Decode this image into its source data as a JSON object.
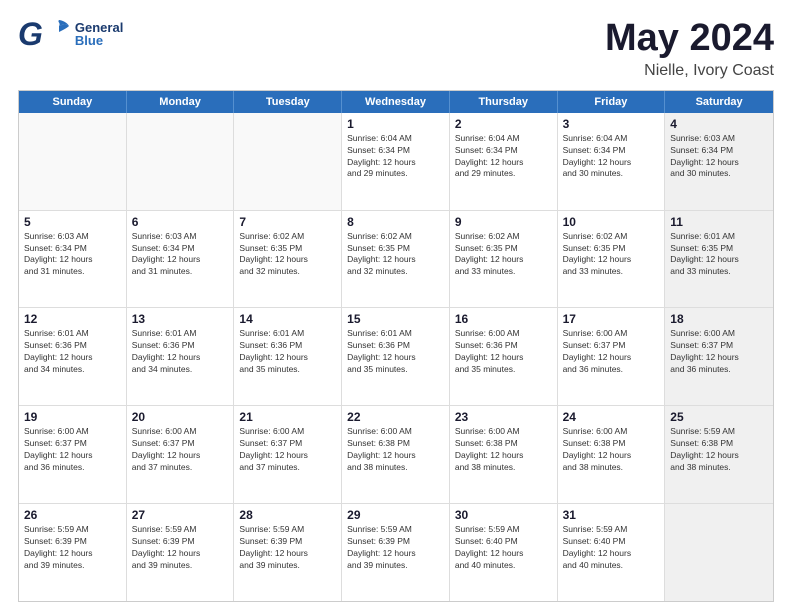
{
  "header": {
    "logo_general": "General",
    "logo_blue": "Blue",
    "title": "May 2024",
    "subtitle": "Nielle, Ivory Coast"
  },
  "days_of_week": [
    "Sunday",
    "Monday",
    "Tuesday",
    "Wednesday",
    "Thursday",
    "Friday",
    "Saturday"
  ],
  "weeks": [
    [
      {
        "day": "",
        "empty": true
      },
      {
        "day": "",
        "empty": true
      },
      {
        "day": "",
        "empty": true
      },
      {
        "day": "1",
        "line1": "Sunrise: 6:04 AM",
        "line2": "Sunset: 6:34 PM",
        "line3": "Daylight: 12 hours",
        "line4": "and 29 minutes."
      },
      {
        "day": "2",
        "line1": "Sunrise: 6:04 AM",
        "line2": "Sunset: 6:34 PM",
        "line3": "Daylight: 12 hours",
        "line4": "and 29 minutes."
      },
      {
        "day": "3",
        "line1": "Sunrise: 6:04 AM",
        "line2": "Sunset: 6:34 PM",
        "line3": "Daylight: 12 hours",
        "line4": "and 30 minutes."
      },
      {
        "day": "4",
        "shaded": true,
        "line1": "Sunrise: 6:03 AM",
        "line2": "Sunset: 6:34 PM",
        "line3": "Daylight: 12 hours",
        "line4": "and 30 minutes."
      }
    ],
    [
      {
        "day": "5",
        "line1": "Sunrise: 6:03 AM",
        "line2": "Sunset: 6:34 PM",
        "line3": "Daylight: 12 hours",
        "line4": "and 31 minutes."
      },
      {
        "day": "6",
        "line1": "Sunrise: 6:03 AM",
        "line2": "Sunset: 6:34 PM",
        "line3": "Daylight: 12 hours",
        "line4": "and 31 minutes."
      },
      {
        "day": "7",
        "line1": "Sunrise: 6:02 AM",
        "line2": "Sunset: 6:35 PM",
        "line3": "Daylight: 12 hours",
        "line4": "and 32 minutes."
      },
      {
        "day": "8",
        "line1": "Sunrise: 6:02 AM",
        "line2": "Sunset: 6:35 PM",
        "line3": "Daylight: 12 hours",
        "line4": "and 32 minutes."
      },
      {
        "day": "9",
        "line1": "Sunrise: 6:02 AM",
        "line2": "Sunset: 6:35 PM",
        "line3": "Daylight: 12 hours",
        "line4": "and 33 minutes."
      },
      {
        "day": "10",
        "line1": "Sunrise: 6:02 AM",
        "line2": "Sunset: 6:35 PM",
        "line3": "Daylight: 12 hours",
        "line4": "and 33 minutes."
      },
      {
        "day": "11",
        "shaded": true,
        "line1": "Sunrise: 6:01 AM",
        "line2": "Sunset: 6:35 PM",
        "line3": "Daylight: 12 hours",
        "line4": "and 33 minutes."
      }
    ],
    [
      {
        "day": "12",
        "line1": "Sunrise: 6:01 AM",
        "line2": "Sunset: 6:36 PM",
        "line3": "Daylight: 12 hours",
        "line4": "and 34 minutes."
      },
      {
        "day": "13",
        "line1": "Sunrise: 6:01 AM",
        "line2": "Sunset: 6:36 PM",
        "line3": "Daylight: 12 hours",
        "line4": "and 34 minutes."
      },
      {
        "day": "14",
        "line1": "Sunrise: 6:01 AM",
        "line2": "Sunset: 6:36 PM",
        "line3": "Daylight: 12 hours",
        "line4": "and 35 minutes."
      },
      {
        "day": "15",
        "line1": "Sunrise: 6:01 AM",
        "line2": "Sunset: 6:36 PM",
        "line3": "Daylight: 12 hours",
        "line4": "and 35 minutes."
      },
      {
        "day": "16",
        "line1": "Sunrise: 6:00 AM",
        "line2": "Sunset: 6:36 PM",
        "line3": "Daylight: 12 hours",
        "line4": "and 35 minutes."
      },
      {
        "day": "17",
        "line1": "Sunrise: 6:00 AM",
        "line2": "Sunset: 6:37 PM",
        "line3": "Daylight: 12 hours",
        "line4": "and 36 minutes."
      },
      {
        "day": "18",
        "shaded": true,
        "line1": "Sunrise: 6:00 AM",
        "line2": "Sunset: 6:37 PM",
        "line3": "Daylight: 12 hours",
        "line4": "and 36 minutes."
      }
    ],
    [
      {
        "day": "19",
        "line1": "Sunrise: 6:00 AM",
        "line2": "Sunset: 6:37 PM",
        "line3": "Daylight: 12 hours",
        "line4": "and 36 minutes."
      },
      {
        "day": "20",
        "line1": "Sunrise: 6:00 AM",
        "line2": "Sunset: 6:37 PM",
        "line3": "Daylight: 12 hours",
        "line4": "and 37 minutes."
      },
      {
        "day": "21",
        "line1": "Sunrise: 6:00 AM",
        "line2": "Sunset: 6:37 PM",
        "line3": "Daylight: 12 hours",
        "line4": "and 37 minutes."
      },
      {
        "day": "22",
        "line1": "Sunrise: 6:00 AM",
        "line2": "Sunset: 6:38 PM",
        "line3": "Daylight: 12 hours",
        "line4": "and 38 minutes."
      },
      {
        "day": "23",
        "line1": "Sunrise: 6:00 AM",
        "line2": "Sunset: 6:38 PM",
        "line3": "Daylight: 12 hours",
        "line4": "and 38 minutes."
      },
      {
        "day": "24",
        "line1": "Sunrise: 6:00 AM",
        "line2": "Sunset: 6:38 PM",
        "line3": "Daylight: 12 hours",
        "line4": "and 38 minutes."
      },
      {
        "day": "25",
        "shaded": true,
        "line1": "Sunrise: 5:59 AM",
        "line2": "Sunset: 6:38 PM",
        "line3": "Daylight: 12 hours",
        "line4": "and 38 minutes."
      }
    ],
    [
      {
        "day": "26",
        "line1": "Sunrise: 5:59 AM",
        "line2": "Sunset: 6:39 PM",
        "line3": "Daylight: 12 hours",
        "line4": "and 39 minutes."
      },
      {
        "day": "27",
        "line1": "Sunrise: 5:59 AM",
        "line2": "Sunset: 6:39 PM",
        "line3": "Daylight: 12 hours",
        "line4": "and 39 minutes."
      },
      {
        "day": "28",
        "line1": "Sunrise: 5:59 AM",
        "line2": "Sunset: 6:39 PM",
        "line3": "Daylight: 12 hours",
        "line4": "and 39 minutes."
      },
      {
        "day": "29",
        "line1": "Sunrise: 5:59 AM",
        "line2": "Sunset: 6:39 PM",
        "line3": "Daylight: 12 hours",
        "line4": "and 39 minutes."
      },
      {
        "day": "30",
        "line1": "Sunrise: 5:59 AM",
        "line2": "Sunset: 6:40 PM",
        "line3": "Daylight: 12 hours",
        "line4": "and 40 minutes."
      },
      {
        "day": "31",
        "line1": "Sunrise: 5:59 AM",
        "line2": "Sunset: 6:40 PM",
        "line3": "Daylight: 12 hours",
        "line4": "and 40 minutes."
      },
      {
        "day": "",
        "empty": true,
        "shaded": true
      }
    ]
  ]
}
